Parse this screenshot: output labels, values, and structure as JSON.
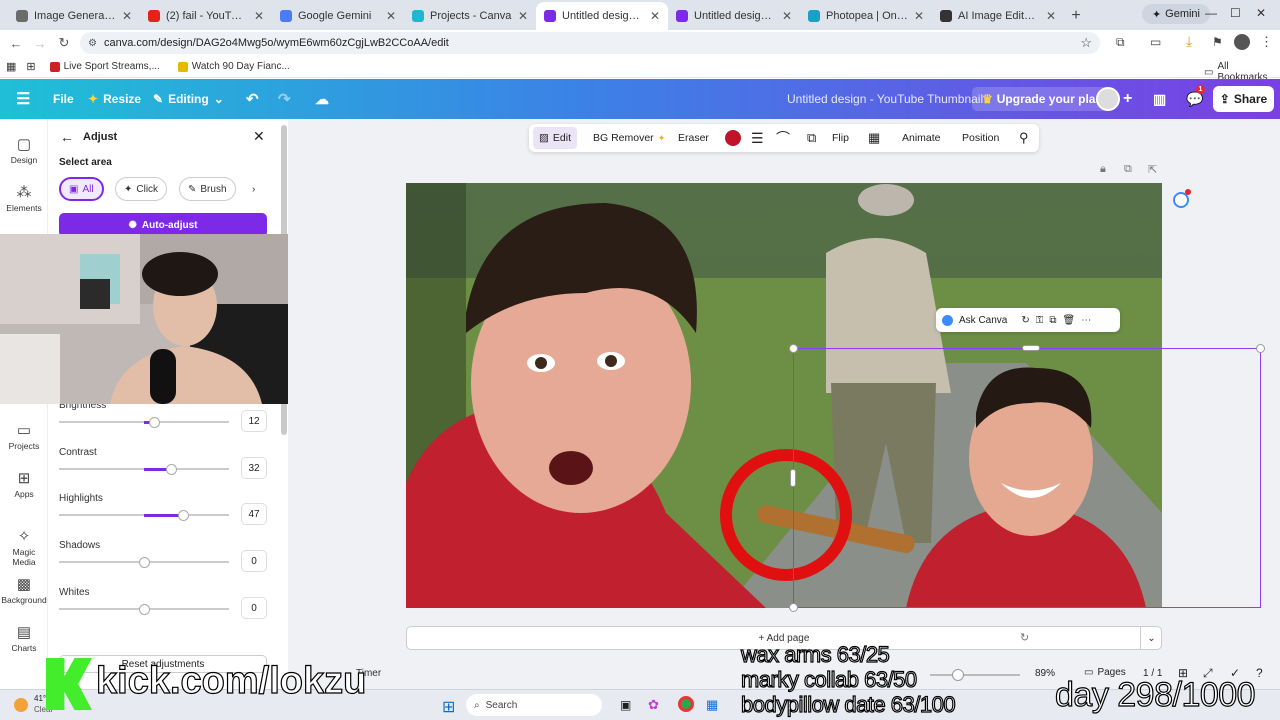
{
  "browser": {
    "tabs": [
      {
        "title": "Image Generation: Sup",
        "color": "#6b6b6b"
      },
      {
        "title": "(2) fail - YouTube",
        "color": "#e62117"
      },
      {
        "title": "Google Gemini",
        "color": "#4a7bf5"
      },
      {
        "title": "Projects - Canva",
        "color": "#1fb6d1"
      },
      {
        "title": "Untitled design - YouTu",
        "color": "#7d2ae8",
        "active": true
      },
      {
        "title": "Untitled design - YouTu",
        "color": "#7d2ae8"
      },
      {
        "title": "Photopea | Online Phot",
        "color": "#19a0c7"
      },
      {
        "title": "AI Image Editor - Pixel",
        "color": "#333333"
      }
    ],
    "new_tab": "+",
    "gemini_button": "Gemini",
    "url": "canva.com/design/DAG2o4Mwg5o/wymE6wm60zCgjLwB2CCoAA/edit",
    "bookmarks": [
      "Live Sport Streams,...",
      "Watch 90 Day Fianc..."
    ],
    "all_bookmarks": "All Bookmarks"
  },
  "canva_header": {
    "file": "File",
    "resize": "Resize",
    "editing": "Editing",
    "title": "Untitled design - YouTube Thumbnail",
    "upgrade": "Upgrade your plan",
    "notif_count": "1",
    "share": "Share"
  },
  "rail": {
    "items": [
      "Design",
      "Elements",
      "Projects",
      "Apps",
      "Magic Media",
      "Background",
      "Charts"
    ]
  },
  "adjust_panel": {
    "title": "Adjust",
    "select_area": "Select area",
    "segments": [
      "All",
      "Click",
      "Brush"
    ],
    "auto_adjust": "Auto-adjust",
    "sliders": [
      {
        "label": "Brightness",
        "value": "12",
        "level": 12
      },
      {
        "label": "Contrast",
        "value": "32",
        "level": 32
      },
      {
        "label": "Highlights",
        "value": "47",
        "level": 47
      },
      {
        "label": "Shadows",
        "value": "0",
        "level": 0
      },
      {
        "label": "Whites",
        "value": "0",
        "level": 0
      }
    ],
    "reset": "Reset adjustments"
  },
  "toolbar": {
    "edit": "Edit",
    "bg_remover": "BG Remover",
    "eraser": "Eraser",
    "color": "#c0142a",
    "flip": "Flip",
    "animate": "Animate",
    "position": "Position"
  },
  "canvas": {
    "ask_canva": "Ask Canva",
    "add_page": "+ Add page"
  },
  "footer": {
    "timer": "Timer",
    "zoom": "89%",
    "pages_label": "Pages",
    "page_count": "1 / 1"
  },
  "taskbar": {
    "search": "Search",
    "weather_temp": "41°F",
    "weather_desc": "Clear"
  },
  "stream_overlay": {
    "kick": "kick.com/lokzu",
    "goals": [
      "wax arms 63/25",
      "marky collab 63/50",
      "bodypillow date 63/100"
    ],
    "day": "day 298/1000"
  }
}
